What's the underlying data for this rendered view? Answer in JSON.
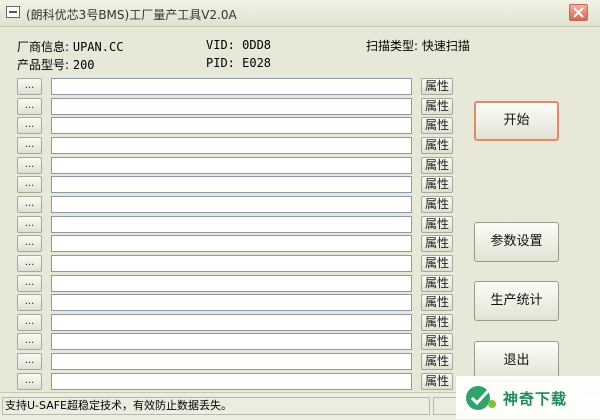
{
  "window": {
    "title": "(朗科优芯3号BMS)工厂量产工具V2.0A",
    "close_label": "×"
  },
  "info": {
    "vendor_label": "厂商信息: ",
    "vendor_value": "UPAN.CC",
    "product_label": "产品型号: ",
    "product_value": "200",
    "vid_label": "VID: ",
    "vid_value": "0DD8",
    "pid_label": "PID: ",
    "pid_value": "E028",
    "scan_label": "扫描类型: ",
    "scan_value": "快速扫描"
  },
  "rows": {
    "button_label": "...",
    "attr_label": "属性",
    "count": 16
  },
  "buttons": {
    "start": "开始",
    "params": "参数设置",
    "stats": "生产统计",
    "exit": "退出"
  },
  "status": {
    "text": "支持U-SAFE超稳定技术，有效防止数据丢失。"
  },
  "watermark": {
    "text": "神奇下载"
  },
  "colors": {
    "background": "#e8e8d8",
    "start_border": "#e08a6a",
    "watermark": "#1f8a5a"
  }
}
